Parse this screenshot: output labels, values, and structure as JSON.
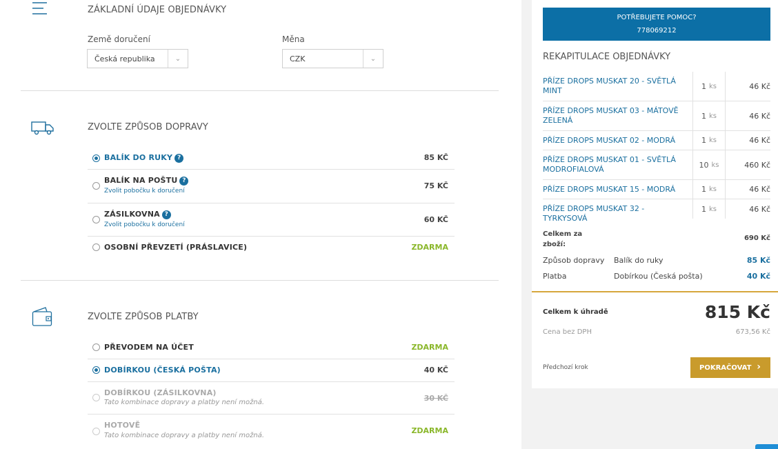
{
  "order_info": {
    "title": "ZÁKLADNÍ ÚDAJE OBJEDNÁVKY",
    "country_label": "Země doručení",
    "country_value": "Česká republika",
    "currency_label": "Měna",
    "currency_value": "CZK"
  },
  "shipping": {
    "title": "ZVOLTE ZPŮSOB DOPRAVY",
    "options": [
      {
        "label": "BALÍK DO RUKY",
        "price": "85 KČ",
        "selected": true,
        "help": "?"
      },
      {
        "label": "BALÍK NA POŠTU",
        "sub": "Zvolit pobočku k doručení",
        "price": "75 KČ",
        "help": "?"
      },
      {
        "label": "ZÁSILKOVNA",
        "sub": "Zvolit pobočku k doručení",
        "price": "60 KČ",
        "help": "?"
      },
      {
        "label": "OSOBNÍ PŘEVZETÍ (PRÁSLAVICE)",
        "price": "ZDARMA"
      }
    ]
  },
  "payment": {
    "title": "ZVOLTE ZPŮSOB PLATBY",
    "options": [
      {
        "label": "PŘEVODEM NA ÚČET",
        "price": "ZDARMA"
      },
      {
        "label": "DOBÍRKOU (ČESKÁ POŠTA)",
        "price": "40 KČ",
        "selected": true
      },
      {
        "label": "DOBÍRKOU (ZÁSILKOVNA)",
        "sub": "Tato kombinace dopravy a platby není možná.",
        "price": "30 KČ",
        "disabled": true
      },
      {
        "label": "HOTOVĚ",
        "sub": "Tato kombinace dopravy a platby není možná.",
        "price": "ZDARMA",
        "disabled": true
      }
    ]
  },
  "help_box": {
    "line1": "POTŘEBUJETE POMOC?",
    "line2": "778069212"
  },
  "recap": {
    "title": "REKAPITULACE OBJEDNÁVKY",
    "unit": "ks",
    "items": [
      {
        "name": "PŘÍZE DROPS MUSKAT 20 - SVĚTLÁ MINT",
        "qty": "1",
        "price": "46 Kč"
      },
      {
        "name": "PŘÍZE DROPS MUSKAT 03 - MÁTOVĚ ZELENÁ",
        "qty": "1",
        "price": "46 Kč"
      },
      {
        "name": "PŘÍZE DROPS MUSKAT 02 - MODRÁ",
        "qty": "1",
        "price": "46 Kč"
      },
      {
        "name": "PŘÍZE DROPS MUSKAT 01 - SVĚTLÁ MODROFIALOVÁ",
        "qty": "10",
        "price": "460 Kč"
      },
      {
        "name": "PŘÍZE DROPS MUSKAT 15 - MODRÁ",
        "qty": "1",
        "price": "46 Kč"
      },
      {
        "name": "PŘÍZE DROPS MUSKAT 32 - TYRKYSOVÁ",
        "qty": "1",
        "price": "46 Kč"
      }
    ],
    "goods_total_label_1": "Celkem za",
    "goods_total_label_2": "zboží:",
    "goods_total_value": "690 Kč",
    "shipping_label": "Způsob dopravy",
    "shipping_method": "Balík do ruky",
    "shipping_price": "85 Kč",
    "payment_label": "Platba",
    "payment_method": "Dobírkou (Česká pošta)",
    "payment_price": "40 Kč",
    "grand_total_label": "Celkem k úhradě",
    "grand_total_value": "815 Kč",
    "net_label": "Cena bez DPH",
    "net_value": "673,56 Kč",
    "prev_step": "Předchozí krok",
    "continue": "POKRAČOVAT"
  },
  "colors": {
    "accent": "#1a6f9f",
    "free": "#8ab72a",
    "button": "#c99b2c",
    "help_box": "#0c6fa6"
  },
  "icons": {
    "order": "list-lines-icon",
    "shipping": "truck-icon",
    "payment": "wallet-icon",
    "caret": "chevron-down-icon",
    "continue": "chevron-right-icon"
  }
}
